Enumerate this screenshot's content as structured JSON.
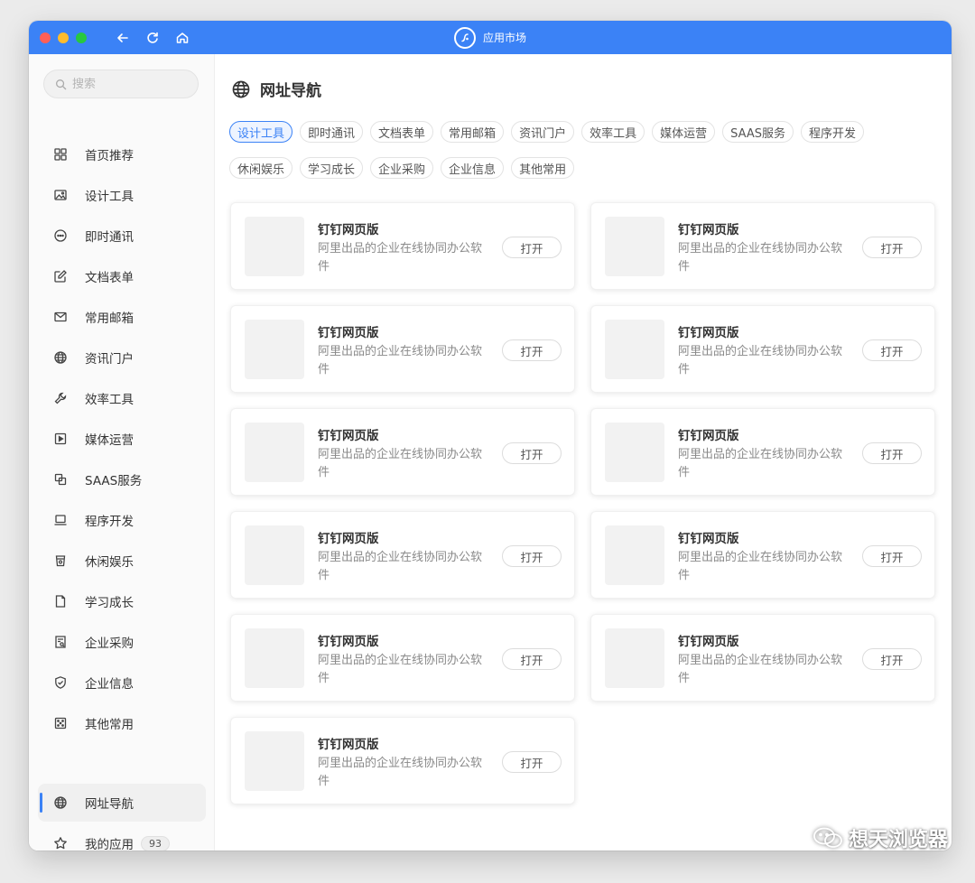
{
  "window": {
    "title": "应用市场",
    "accent": "#3b82f6"
  },
  "search": {
    "placeholder": "搜索"
  },
  "sidebar": {
    "items": [
      {
        "label": "首页推荐",
        "icon": "grid-icon"
      },
      {
        "label": "设计工具",
        "icon": "image-icon"
      },
      {
        "label": "即时通讯",
        "icon": "chat-icon"
      },
      {
        "label": "文档表单",
        "icon": "edit-icon"
      },
      {
        "label": "常用邮箱",
        "icon": "mail-icon"
      },
      {
        "label": "资讯门户",
        "icon": "globe-icon"
      },
      {
        "label": "效率工具",
        "icon": "wrench-icon"
      },
      {
        "label": "媒体运营",
        "icon": "play-icon"
      },
      {
        "label": "SAAS服务",
        "icon": "copy-icon"
      },
      {
        "label": "程序开发",
        "icon": "laptop-icon"
      },
      {
        "label": "休闲娱乐",
        "icon": "cup-icon"
      },
      {
        "label": "学习成长",
        "icon": "book-icon"
      },
      {
        "label": "企业采购",
        "icon": "receipt-icon"
      },
      {
        "label": "企业信息",
        "icon": "shield-icon"
      },
      {
        "label": "其他常用",
        "icon": "dice-icon"
      }
    ],
    "bottom": {
      "nav_label": "网址导航",
      "my_apps_label": "我的应用",
      "my_apps_count": "93"
    }
  },
  "main": {
    "title": "网址导航",
    "tags": [
      "设计工具",
      "即时通讯",
      "文档表单",
      "常用邮箱",
      "资讯门户",
      "效率工具",
      "媒体运营",
      "SAAS服务",
      "程序开发",
      "休闲娱乐",
      "学习成长",
      "企业采购",
      "企业信息",
      "其他常用"
    ],
    "active_tag": "设计工具",
    "cards": [
      {
        "name": "钉钉网页版",
        "desc": "阿里出品的企业在线协同办公软件",
        "button": "打开"
      },
      {
        "name": "钉钉网页版",
        "desc": "阿里出品的企业在线协同办公软件",
        "button": "打开"
      },
      {
        "name": "钉钉网页版",
        "desc": "阿里出品的企业在线协同办公软件",
        "button": "打开"
      },
      {
        "name": "钉钉网页版",
        "desc": "阿里出品的企业在线协同办公软件",
        "button": "打开"
      },
      {
        "name": "钉钉网页版",
        "desc": "阿里出品的企业在线协同办公软件",
        "button": "打开"
      },
      {
        "name": "钉钉网页版",
        "desc": "阿里出品的企业在线协同办公软件",
        "button": "打开"
      },
      {
        "name": "钉钉网页版",
        "desc": "阿里出品的企业在线协同办公软件",
        "button": "打开"
      },
      {
        "name": "钉钉网页版",
        "desc": "阿里出品的企业在线协同办公软件",
        "button": "打开"
      },
      {
        "name": "钉钉网页版",
        "desc": "阿里出品的企业在线协同办公软件",
        "button": "打开"
      },
      {
        "name": "钉钉网页版",
        "desc": "阿里出品的企业在线协同办公软件",
        "button": "打开"
      },
      {
        "name": "钉钉网页版",
        "desc": "阿里出品的企业在线协同办公软件",
        "button": "打开"
      }
    ]
  },
  "watermark": {
    "text": "想天浏览器"
  }
}
